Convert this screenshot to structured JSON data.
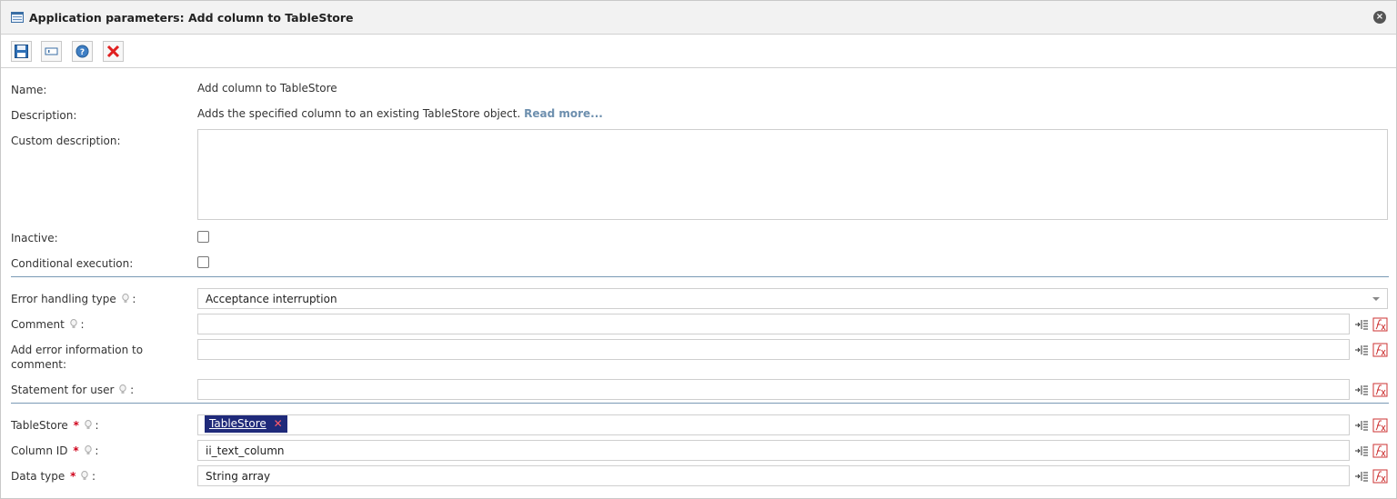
{
  "window": {
    "title": "Application parameters: Add column to TableStore",
    "close_glyph": "×"
  },
  "toolbar": {
    "buttons": [
      {
        "name": "save-button",
        "icon": "floppy-disk-icon"
      },
      {
        "name": "placeholder-button",
        "icon": "text-field-icon"
      },
      {
        "name": "help-button",
        "icon": "help-icon"
      },
      {
        "name": "cancel-button",
        "icon": "red-x-icon"
      }
    ]
  },
  "form": {
    "name_label": "Name:",
    "name_value": "Add column to TableStore",
    "description_label": "Description:",
    "description_value": "Adds the specified column to an existing TableStore object.",
    "read_more": "Read more...",
    "custom_description_label": "Custom description:",
    "custom_description_value": "",
    "inactive_label": "Inactive:",
    "inactive_checked": false,
    "conditional_label": "Conditional execution:",
    "conditional_checked": false,
    "error_handling_label": "Error handling type",
    "error_handling_value": "Acceptance interruption",
    "comment_label": "Comment",
    "comment_value": "",
    "add_error_label": "Add error information to comment:",
    "add_error_value": "",
    "statement_label": "Statement for user",
    "statement_value": "",
    "tablestore_label": "TableStore",
    "tablestore_tag": "TableStore",
    "tag_remove_glyph": "✕",
    "column_id_label": "Column ID",
    "column_id_value": "ii_text_column",
    "data_type_label": "Data type",
    "data_type_value": "String array",
    "colon": ":",
    "required_mark": "*"
  },
  "colors": {
    "accent": "#1f2a7a",
    "separator": "#7a9ab5",
    "required": "#d0021b",
    "link": "#6d8fae"
  }
}
